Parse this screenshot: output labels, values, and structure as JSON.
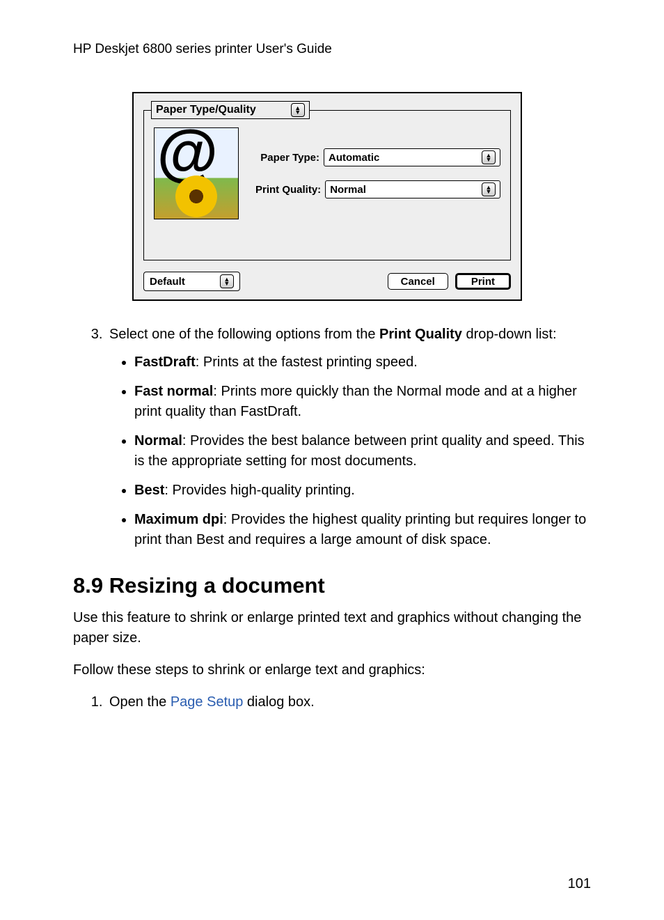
{
  "header": "HP Deskjet 6800 series printer User's Guide",
  "dialog": {
    "tab_label": "Paper Type/Quality",
    "paper_type_label": "Paper Type:",
    "paper_type_value": "Automatic",
    "print_quality_label": "Print Quality:",
    "print_quality_value": "Normal",
    "preset_label": "Default",
    "cancel_label": "Cancel",
    "print_label": "Print"
  },
  "step3": {
    "intro_pre": "Select one of the following options from the ",
    "intro_bold": "Print Quality",
    "intro_post": " drop-down list:",
    "items": [
      {
        "term": "FastDraft",
        "desc": ": Prints at the fastest printing speed."
      },
      {
        "term": "Fast normal",
        "desc": ": Prints more quickly than the Normal mode and at a higher print quality than FastDraft."
      },
      {
        "term": "Normal",
        "desc": ": Provides the best balance between print quality and speed. This is the appropriate setting for most documents."
      },
      {
        "term": "Best",
        "desc": ": Provides high-quality printing."
      },
      {
        "term": "Maximum dpi",
        "desc": ": Provides the highest quality printing but requires longer to print than Best and requires a large amount of disk space."
      }
    ]
  },
  "section": {
    "title": "8.9  Resizing a document",
    "p1": "Use this feature to shrink or enlarge printed text and graphics without changing the paper size.",
    "p2": "Follow these steps to shrink or enlarge text and graphics:",
    "step1_pre": "Open the ",
    "step1_link": "Page Setup",
    "step1_post": " dialog box."
  },
  "page_number": "101"
}
